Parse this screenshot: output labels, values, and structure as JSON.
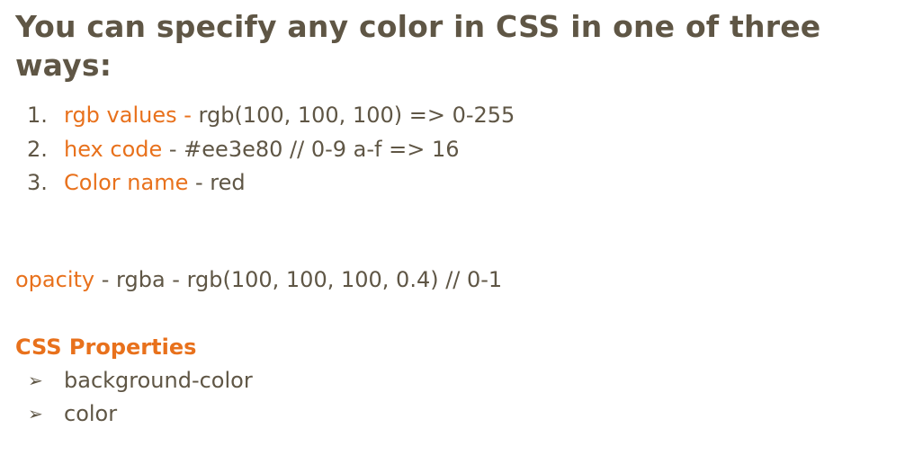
{
  "heading": "You can specify any color in CSS in one of three ways:",
  "ways": [
    {
      "number": "1.",
      "name": "rgb values - ",
      "detail": "rgb(100, 100, 100) => 0-255"
    },
    {
      "number": "2.",
      "name": "hex code",
      "detail": " - #ee3e80 // 0-9 a-f => 16"
    },
    {
      "number": "3.",
      "name": "Color name",
      "detail": " - red"
    }
  ],
  "opacity": {
    "term": "opacity",
    "detail": " - rgba - rgb(100, 100, 100, 0.4) // 0-1"
  },
  "properties": {
    "heading": "CSS Properties",
    "bullet": "➢",
    "items": [
      "background-color",
      "color"
    ]
  },
  "colors": {
    "text": "#5f5645",
    "accent": "#e8711c",
    "background": "#ffffff"
  }
}
